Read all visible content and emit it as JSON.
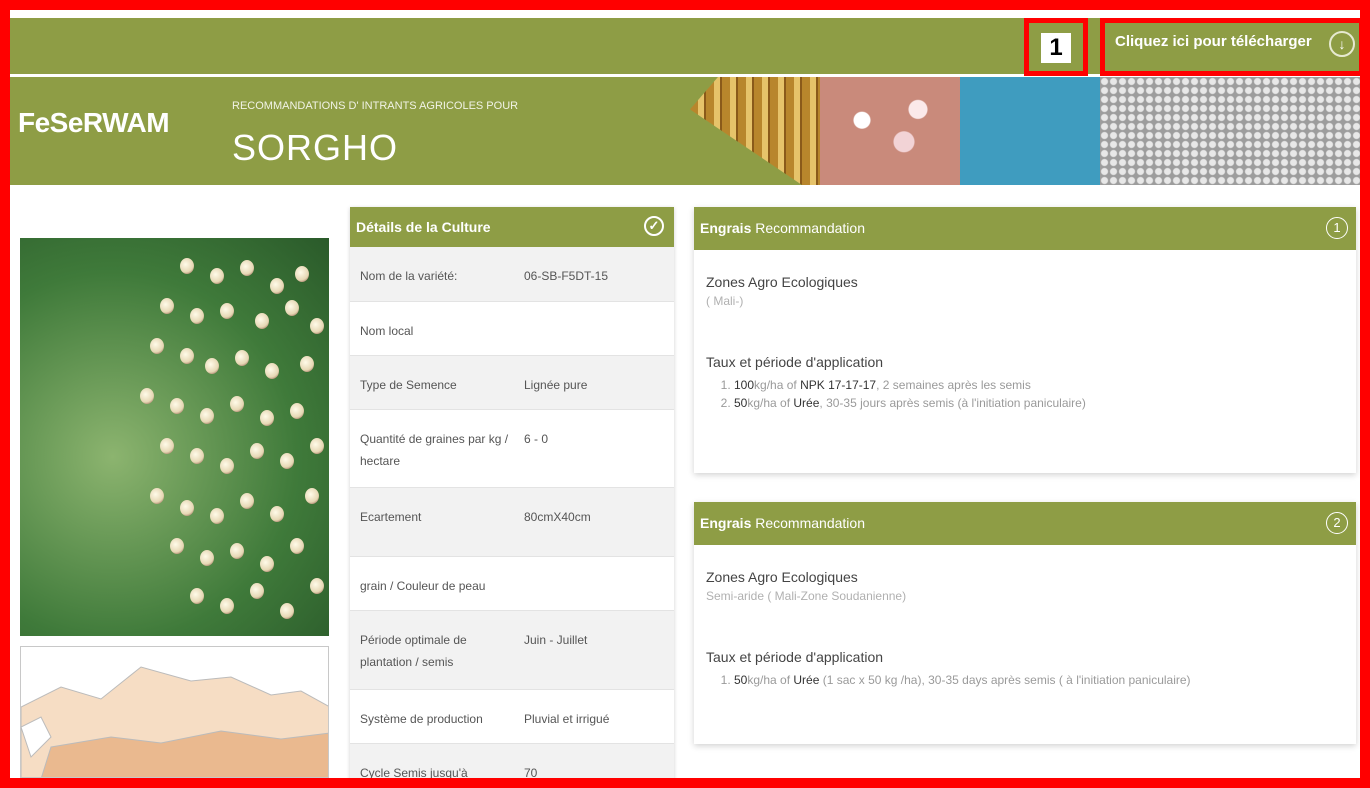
{
  "header": {
    "download_label": "Cliquez ici pour télécharger",
    "callout_number": "1",
    "brand": "FeSeRWAM",
    "subtitle": "RECOMMANDATIONS D' INTRANTS AGRICOLES POUR",
    "crop": "SORGHO"
  },
  "details": {
    "title": "Détails de la Culture",
    "rows": [
      {
        "key": "Nom de la variété:",
        "value": "06-SB-F5DT-15"
      },
      {
        "key": "Nom local",
        "value": ""
      },
      {
        "key": "Type de Semence",
        "value": "Lignée pure"
      },
      {
        "key": "Quantité de graines par kg / hectare",
        "value": "6 - 0"
      },
      {
        "key": "Ecartement",
        "value": "80cmX40cm"
      },
      {
        "key": "grain / Couleur de peau",
        "value": ""
      },
      {
        "key": "Période optimale de plantation / semis",
        "value": "Juin - Juillet"
      },
      {
        "key": "Système de production",
        "value": "Pluvial et irrigué"
      },
      {
        "key": "Cycle Semis jusqu'à",
        "value": "70"
      }
    ]
  },
  "recommendations": [
    {
      "title_bold": "Engrais",
      "title_rest": "Recommandation",
      "number": "1",
      "zones_label": "Zones Agro Ecologiques",
      "zones_value": "( Mali-)",
      "rate_label": "Taux et période d'application",
      "items": [
        {
          "a": "100",
          "b": "kg/ha of ",
          "c": "NPK 17-17-17",
          "d": ", 2 semaines après les semis"
        },
        {
          "a": "50",
          "b": "kg/ha of ",
          "c": "Urée",
          "d": ", 30-35 jours après semis (à l'initiation paniculaire)"
        }
      ]
    },
    {
      "title_bold": "Engrais",
      "title_rest": "Recommandation",
      "number": "2",
      "zones_label": "Zones Agro Ecologiques",
      "zones_value": "Semi-aride ( Mali-Zone Soudanienne)",
      "rate_label": "Taux et période d'application",
      "items": [
        {
          "a": "50",
          "b": "kg/ha of ",
          "c": "Urée",
          "d": " (1 sac x 50 kg /ha), 30-35 days après semis ( à l'initiation paniculaire)"
        }
      ]
    }
  ],
  "colors": {
    "accent": "#8e9d45",
    "highlight": "#ff0000"
  }
}
